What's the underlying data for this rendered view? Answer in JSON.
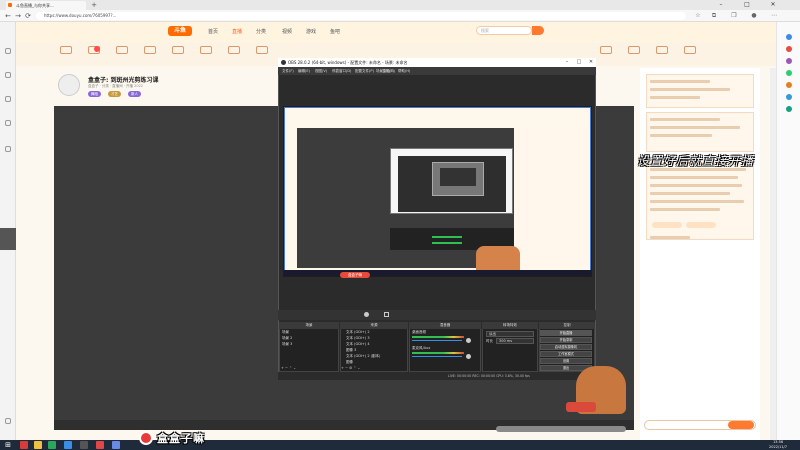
{
  "browser": {
    "tab_title": "斗鱼直播_与你共享...",
    "url": "https://www.douyu.com/7605997?...",
    "nav": {
      "back": "←",
      "forward": "→",
      "refresh": "⟳"
    }
  },
  "douyu": {
    "logo": "斗鱼",
    "nav_links": [
      "首页",
      "直播",
      "分类",
      "视频",
      "游戏",
      "鱼吧"
    ],
    "search_placeholder": "搜索",
    "live_button": "开播",
    "room": {
      "title": "盒盒子: 到斑州光剪练习课",
      "meta": "盒盒子 · 分类 · 直播间 · 开播 2022",
      "tags": [
        "舞蹈",
        "才艺",
        "新人"
      ]
    }
  },
  "obs": {
    "title": "OBS 28.0.2 (64-bit, windows) - 配置文件: 未命名 - 场景: 未命名",
    "menu": [
      "文件(F)",
      "编辑(E)",
      "视图(V)",
      "停靠窗口(D)",
      "配置文件(P)",
      "场景集合(S)",
      "工具(T)",
      "帮助(H)"
    ],
    "panels": {
      "scenes": "场景",
      "sources": "来源",
      "mixer": "混音器",
      "transitions": "转场特效",
      "controls": "控制"
    },
    "scene_items": [
      "场景",
      "场景 2",
      "场景 3"
    ],
    "source_items": [
      "文本 (GDI+) 2",
      "文本 (GDI+) 3",
      "文本 (GDI+) 4",
      "图像 3",
      "文本 (GDI+) 2 (副本)",
      "图像"
    ],
    "mixer_items": [
      "桌面音频",
      "麦克风/Aux"
    ],
    "transition": {
      "type": "淡出",
      "duration_label": "时长",
      "duration": "300 ms"
    },
    "control_buttons": [
      "开始直播",
      "开始录制",
      "启动虚拟摄像机",
      "工作室模式",
      "设置",
      "退出"
    ],
    "status": "LIVE: 00:00:00   REC: 00:00:00   CPU: 3.8%, 30.00 fps"
  },
  "overlay_text": "设置好后就直接开播",
  "watermark": "盒盒子嘛",
  "taskbar": {
    "time": "13:56",
    "date": "2022/11/7"
  }
}
